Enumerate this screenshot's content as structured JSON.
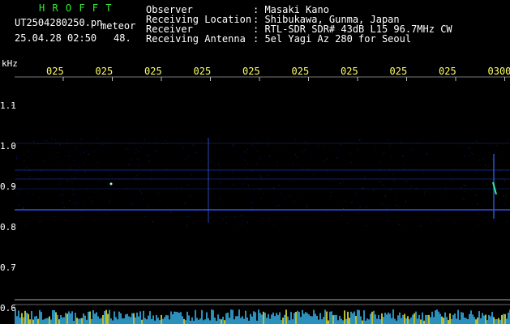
{
  "header": {
    "title": "H R O F F T",
    "filename": "UT2504280250.pn",
    "meteor_label": "meteor",
    "datetime": "25.04.28 02:50",
    "count": "48.",
    "fields": [
      {
        "label": "Observer",
        "value": ": Masaki Kano"
      },
      {
        "label": "Receiving Location",
        "value": ": Shibukawa, Gunma, Japan"
      },
      {
        "label": "Receiver",
        "value": ": RTL-SDR SDR# 43dB L15 96.7MHz CW"
      },
      {
        "label": "Receiving Antenna",
        "value": ": 5el Yagi Az 280 for Seoul"
      }
    ]
  },
  "axes": {
    "y_unit": "kHz",
    "y_ticks": [
      "1.1",
      "1.0",
      "0.9",
      "0.8",
      "0.7",
      "0.6"
    ],
    "x_ticks": [
      "025",
      "025",
      "025",
      "025",
      "025",
      "025",
      "025",
      "025",
      "025",
      "0300"
    ]
  },
  "colors": {
    "background": "#000000",
    "text": "#ffffff",
    "title": "#33ee33",
    "time_labels": "#ffff66",
    "signal": "#2244ff",
    "grid": "#555555"
  }
}
